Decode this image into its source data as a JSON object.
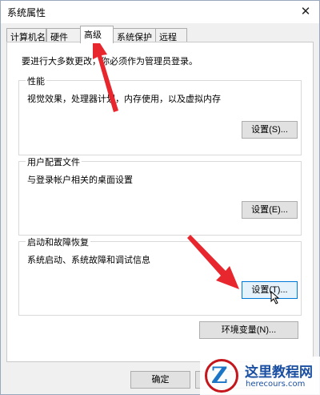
{
  "window": {
    "title": "系统属性",
    "close_glyph": "✕"
  },
  "tabs": [
    {
      "label": "计算机名",
      "active": false
    },
    {
      "label": "硬件",
      "active": false
    },
    {
      "label": "高级",
      "active": true
    },
    {
      "label": "系统保护",
      "active": false
    },
    {
      "label": "远程",
      "active": false
    }
  ],
  "advanced": {
    "admin_note": "要进行大多数更改，你必须作为管理员登录。",
    "performance": {
      "title": "性能",
      "description": "视觉效果，处理器计划，内存使用，以及虚拟内存",
      "button": "设置(S)..."
    },
    "user_profiles": {
      "title": "用户配置文件",
      "description": "与登录帐户相关的桌面设置",
      "button": "设置(E)..."
    },
    "startup_recovery": {
      "title": "启动和故障恢复",
      "description": "系统启动、系统故障和调试信息",
      "button": "设置(T)..."
    },
    "env_vars_button": "环境变量(N)..."
  },
  "footer": {
    "ok_label": "确定"
  },
  "watermark": {
    "title": "这里教程网",
    "url": "herecours.com"
  },
  "annotation_color": "#e8262d",
  "accent_color": "#0078d7"
}
